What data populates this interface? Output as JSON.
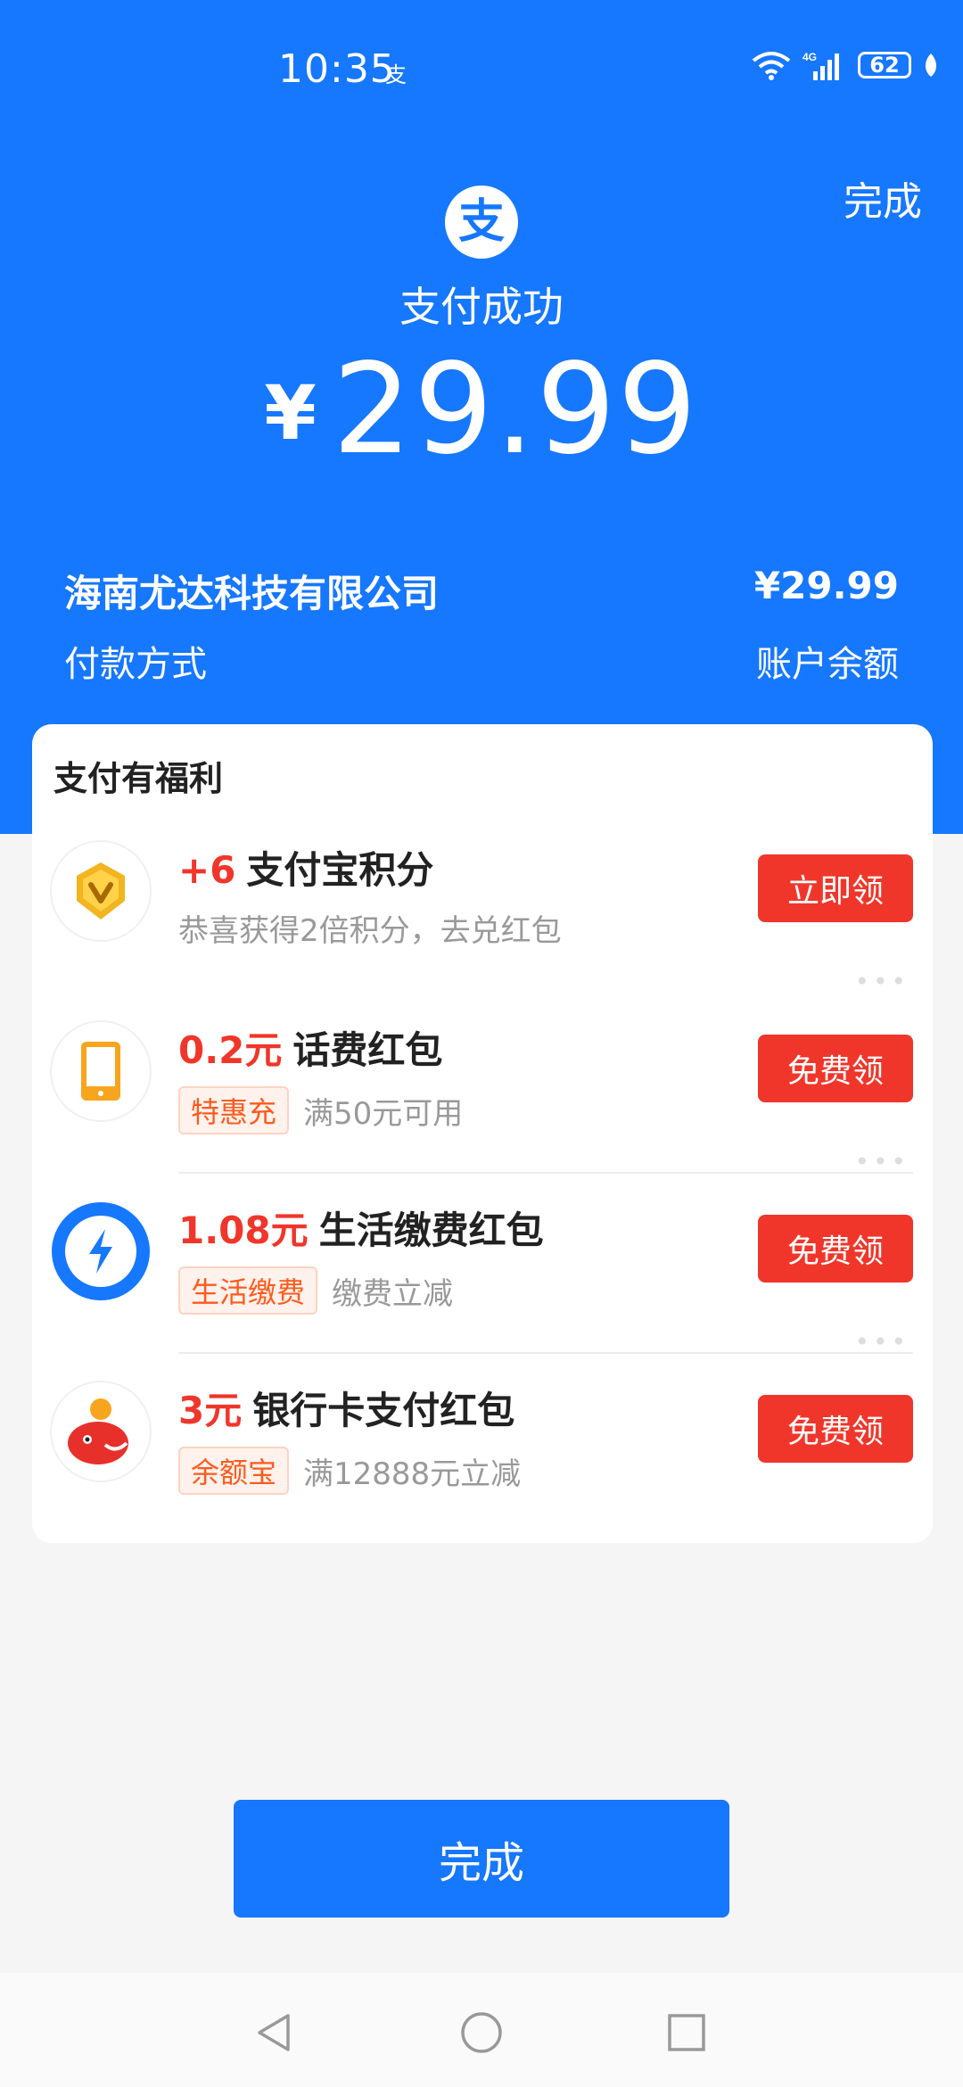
{
  "status_bar": {
    "time": "10:35",
    "app_glyph": "支",
    "battery": "62"
  },
  "header": {
    "done_label": "完成",
    "logo_glyph": "支",
    "title": "支付成功",
    "currency": "¥",
    "amount": "29.99"
  },
  "payment": {
    "merchant": "海南尤达科技有限公司",
    "merchant_amount": "¥29.99",
    "method_label": "付款方式",
    "method_value": "账户余额"
  },
  "benefits": {
    "title": "支付有福利",
    "items": [
      {
        "highlight": "+6",
        "title": "支付宝积分",
        "tag": "",
        "desc": "恭喜获得2倍积分，去兑红包",
        "button": "立即领",
        "icon": "gold-v-coin-icon"
      },
      {
        "highlight": "0.2元",
        "title": "话费红包",
        "tag": "特惠充",
        "desc": "满50元可用",
        "button": "免费领",
        "icon": "phone-icon"
      },
      {
        "highlight": "1.08元",
        "title": "生活缴费红包",
        "tag": "生活缴费",
        "desc": "缴费立减",
        "button": "免费领",
        "icon": "lightning-icon"
      },
      {
        "highlight": "3元",
        "title": "银行卡支付红包",
        "tag": "余额宝",
        "desc": "满12888元立减",
        "button": "免费领",
        "icon": "mascot-icon"
      }
    ]
  },
  "footer": {
    "done_label": "完成"
  },
  "colors": {
    "primary": "#1677ff",
    "red": "#f0362a",
    "tag_orange": "#ff5a1e"
  }
}
